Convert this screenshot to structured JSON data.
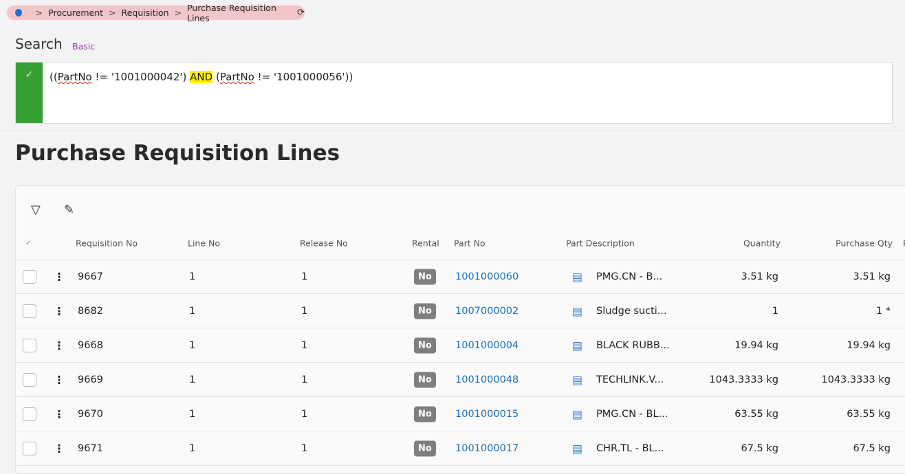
{
  "breadcrumb": {
    "items": [
      "Procurement",
      "Requisition",
      "Purchase Requisition Lines"
    ]
  },
  "search": {
    "label": "Search",
    "mode": "Basic",
    "query_parts": [
      "((",
      "PartNo",
      " != '1001000042') ",
      "AND",
      " (",
      "PartNo",
      " != '1001000056'))"
    ]
  },
  "page_title": "Purchase Requisition Lines",
  "table": {
    "headers": [
      "Requisition No",
      "Line No",
      "Release No",
      "Rental",
      "Part No",
      "Part Description",
      "Quantity",
      "Purchase Qty",
      "P"
    ],
    "rows": [
      {
        "req": "9667",
        "line": "1",
        "release": "1",
        "rental": "No",
        "part": "1001000060",
        "desc": "PMG.CN - B...",
        "qty": "3.51 kg",
        "pqty": "3.51 kg"
      },
      {
        "req": "8682",
        "line": "1",
        "release": "1",
        "rental": "No",
        "part": "1007000002",
        "desc": "Sludge sucti...",
        "qty": "1",
        "pqty": "1 *"
      },
      {
        "req": "9668",
        "line": "1",
        "release": "1",
        "rental": "No",
        "part": "1001000004",
        "desc": "BLACK RUBB...",
        "qty": "19.94 kg",
        "pqty": "19.94 kg"
      },
      {
        "req": "9669",
        "line": "1",
        "release": "1",
        "rental": "No",
        "part": "1001000048",
        "desc": "TECHLINK.V...",
        "qty": "1043.3333 kg",
        "pqty": "1043.3333 kg"
      },
      {
        "req": "9670",
        "line": "1",
        "release": "1",
        "rental": "No",
        "part": "1001000015",
        "desc": "PMG.CN - BL...",
        "qty": "63.55 kg",
        "pqty": "63.55 kg"
      },
      {
        "req": "9671",
        "line": "1",
        "release": "1",
        "rental": "No",
        "part": "1001000017",
        "desc": "CHR.TL - BL...",
        "qty": "67.5 kg",
        "pqty": "67.5 kg"
      }
    ]
  }
}
